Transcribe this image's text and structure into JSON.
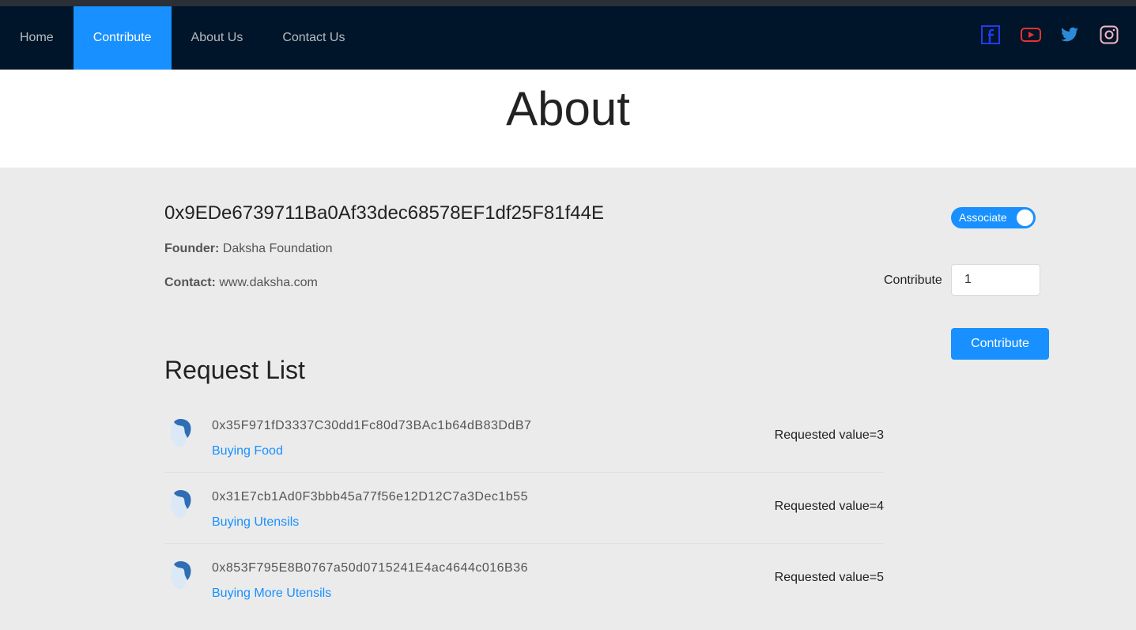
{
  "nav": {
    "items": [
      {
        "label": "Home"
      },
      {
        "label": "Contribute",
        "active": true
      },
      {
        "label": "About Us"
      },
      {
        "label": "Contact Us"
      }
    ],
    "social": [
      {
        "icon": "facebook-icon",
        "color": "#1f3cf0"
      },
      {
        "icon": "youtube-icon",
        "color": "#e8322e"
      },
      {
        "icon": "twitter-icon",
        "color": "#2d8ad6"
      },
      {
        "icon": "instagram-icon",
        "color": "#f4b6c2"
      }
    ]
  },
  "hero": {
    "title": "About"
  },
  "campaign": {
    "address": "0x9EDe6739711Ba0Af33dec68578EF1df25F81f44E",
    "founder_label": "Founder:",
    "founder": "Daksha Foundation",
    "contact_label": "Contact:",
    "contact": "www.daksha.com",
    "toggle_label": "Associate",
    "toggle_on": true,
    "contribute_label": "Contribute",
    "contribute_value": "1",
    "contribute_button": "Contribute"
  },
  "requests": {
    "title": "Request List",
    "items": [
      {
        "address": "0x35F971fD3337C30dd1Fc80d73BAc1b64dB83DdB7",
        "description": "Buying Food",
        "value": "Requested value=3"
      },
      {
        "address": "0x31E7cb1Ad0F3bbb45a77f56e12D12C7a3Dec1b55",
        "description": "Buying Utensils",
        "value": "Requested value=4"
      },
      {
        "address": "0x853F795E8B0767a50d0715241E4ac4644c016B36",
        "description": "Buying More Utensils",
        "value": "Requested value=5"
      }
    ]
  },
  "colors": {
    "accent": "#1890ff",
    "nav_bg": "#001529"
  }
}
